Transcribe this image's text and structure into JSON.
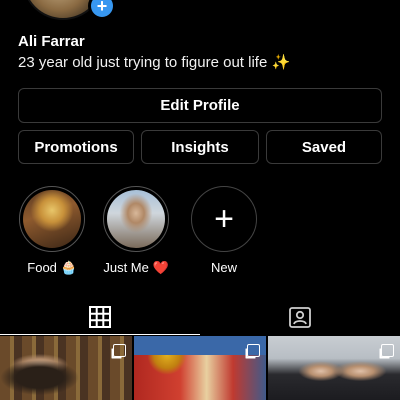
{
  "profile": {
    "name": "Ali Farrar",
    "bio": "23 year old just trying to figure out life ✨"
  },
  "buttons": {
    "edit_profile": "Edit Profile",
    "promotions": "Promotions",
    "insights": "Insights",
    "saved": "Saved"
  },
  "highlights": [
    {
      "label": "Food 🧁"
    },
    {
      "label": "Just Me ❤️"
    },
    {
      "label": "New"
    }
  ],
  "tabs": {
    "grid_icon": "grid-icon",
    "tagged_icon": "tagged-person-icon"
  },
  "colors": {
    "accent": "#3797f0",
    "background": "#000000",
    "button_border": "#3a3a3a"
  }
}
